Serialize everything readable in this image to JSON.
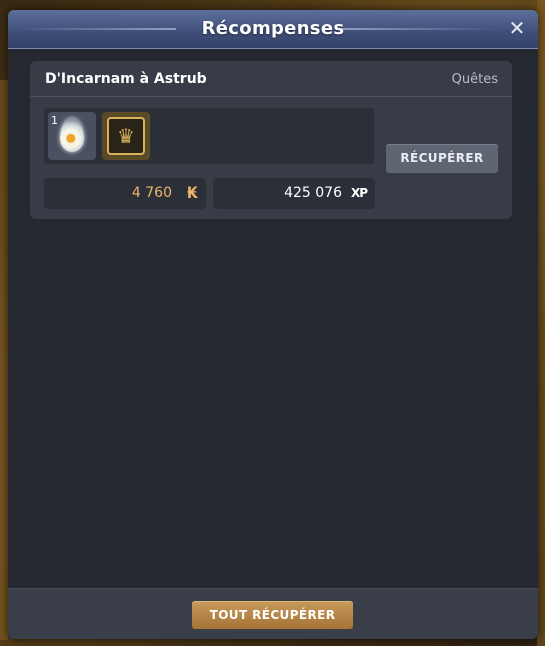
{
  "window": {
    "title": "Récompenses",
    "close_icon": "close-icon"
  },
  "quest": {
    "title": "D'Incarnam à Astrub",
    "category": "Quêtes",
    "items": [
      {
        "icon": "egg-icon",
        "count": "1"
      },
      {
        "icon": "crown-icon",
        "count": ""
      }
    ],
    "recover_label": "RÉCUPÉRER",
    "kamas": "4 760",
    "kamas_icon": "₭",
    "kamas_color": "#f0b46a",
    "xp": "425 076",
    "xp_icon": "XP"
  },
  "footer": {
    "recover_all_label": "TOUT RÉCUPÉRER",
    "button_color": "#b9864a"
  }
}
